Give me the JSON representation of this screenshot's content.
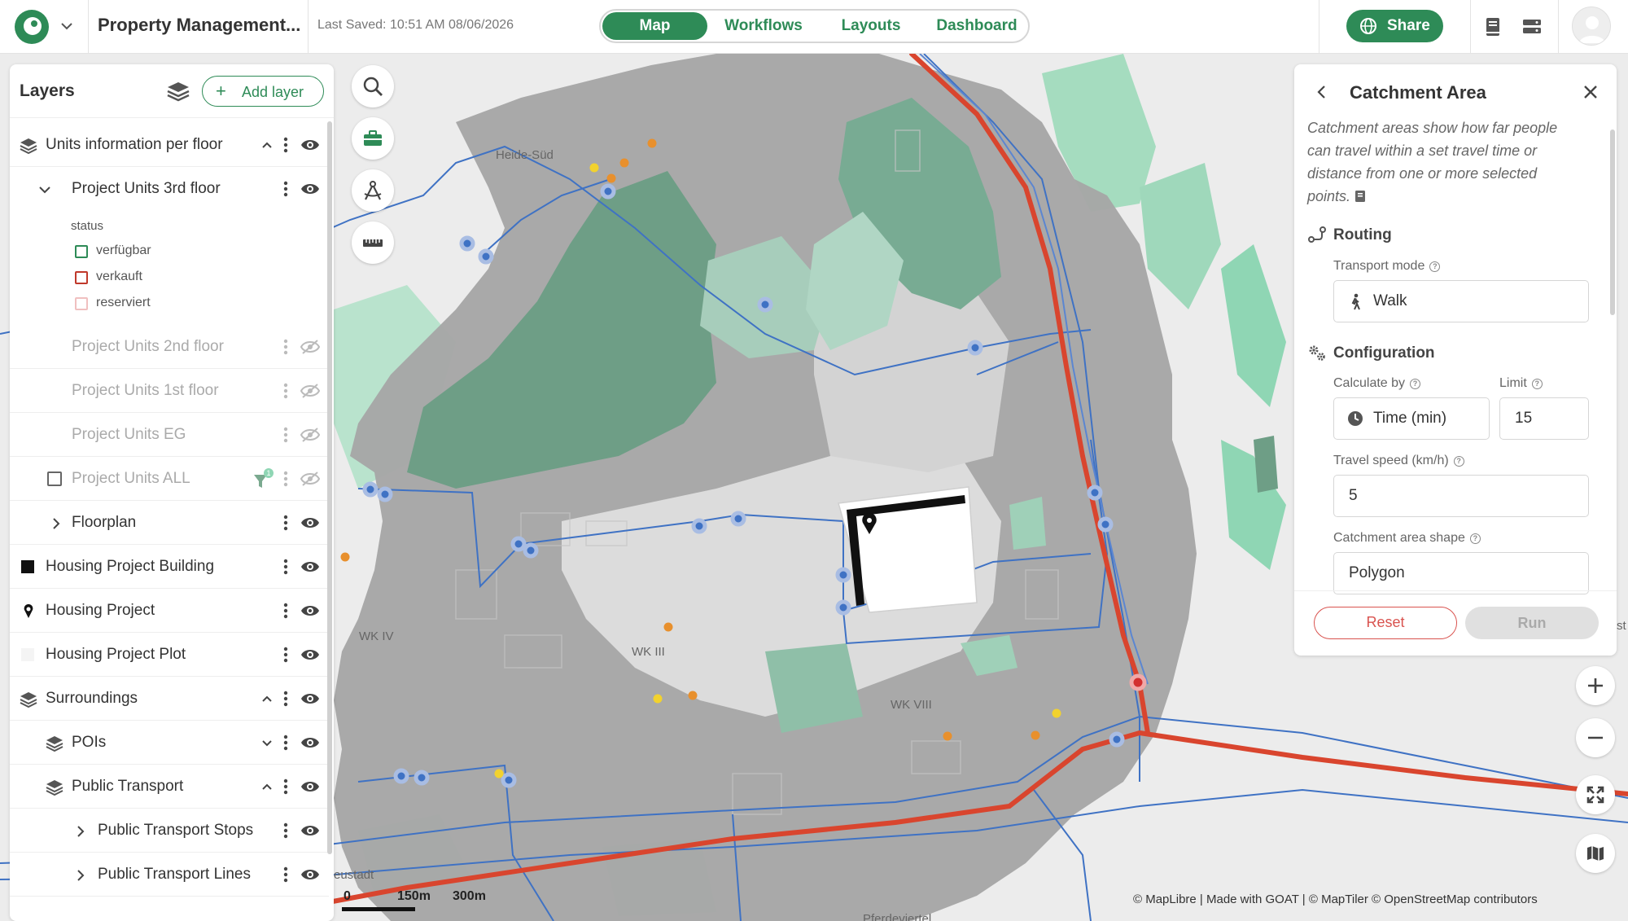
{
  "header": {
    "project_title": "Property Management...",
    "last_saved": "Last Saved: 10:51 AM 08/06/2026",
    "tabs": [
      {
        "label": "Map",
        "active": true
      },
      {
        "label": "Workflows",
        "active": false
      },
      {
        "label": "Layouts",
        "active": false
      },
      {
        "label": "Dashboard",
        "active": false
      }
    ],
    "share_label": "Share"
  },
  "layers_panel": {
    "title": "Layers",
    "add_layer_label": "Add layer",
    "rows": [
      {
        "label": "Units information per floor",
        "visible": true,
        "expanded": true,
        "type": "group"
      },
      {
        "label": "Project Units 3rd floor",
        "visible": true,
        "expanded": true,
        "type": "layer"
      },
      {
        "label": "Project Units 2nd floor",
        "visible": false,
        "type": "layer"
      },
      {
        "label": "Project Units 1st floor",
        "visible": false,
        "type": "layer"
      },
      {
        "label": "Project Units EG",
        "visible": false,
        "type": "layer"
      },
      {
        "label": "Project Units ALL",
        "visible": false,
        "type": "layer",
        "filter_badge": "1"
      },
      {
        "label": "Floorplan",
        "visible": true,
        "type": "layer"
      },
      {
        "label": "Housing Project Building",
        "visible": true,
        "type": "layer"
      },
      {
        "label": "Housing Project",
        "visible": true,
        "type": "layer"
      },
      {
        "label": "Housing Project Plot",
        "visible": true,
        "type": "layer"
      },
      {
        "label": "Surroundings",
        "visible": true,
        "expanded": true,
        "type": "group"
      },
      {
        "label": "POIs",
        "visible": true,
        "type": "group"
      },
      {
        "label": "Public Transport",
        "visible": true,
        "expanded": true,
        "type": "group"
      },
      {
        "label": "Public Transport Stops",
        "visible": true,
        "type": "layer"
      },
      {
        "label": "Public Transport Lines",
        "visible": true,
        "type": "layer"
      }
    ],
    "legend": {
      "title": "status",
      "items": [
        {
          "label": "verfügbar",
          "color": "#2e8b57"
        },
        {
          "label": "verkauft",
          "color": "#c0392b"
        },
        {
          "label": "reserviert",
          "color": "#f0c0c0"
        }
      ]
    }
  },
  "catchment": {
    "title": "Catchment Area",
    "description_lines": [
      "Catchment areas show how far people",
      "can travel within a set travel time or",
      "distance from one or more selected",
      "points."
    ],
    "routing_title": "Routing",
    "transport_mode_label": "Transport mode",
    "transport_mode_value": "Walk",
    "configuration_title": "Configuration",
    "calculate_by_label": "Calculate by",
    "calculate_by_value": "Time (min)",
    "limit_label": "Limit",
    "limit_value": "15",
    "travel_speed_label": "Travel speed (km/h)",
    "travel_speed_value": "5",
    "shape_label": "Catchment area shape",
    "shape_value": "Polygon",
    "reset_label": "Reset",
    "run_label": "Run"
  },
  "map": {
    "labels": [
      "Heide-Süd",
      "WK IV",
      "WK III",
      "WK VIII",
      "eustadt",
      "Pferdeviertel",
      "st"
    ],
    "scale": [
      "0",
      "150m",
      "300m"
    ],
    "attribution": "© MapLibre | Made with GOAT | © MapTiler © OpenStreetMap contributors"
  },
  "colors": {
    "accent": "#2e8b57",
    "catchment_gray": "#9a9a9a",
    "green_area": "#8fd6b4",
    "transit_blue": "#3f72c4",
    "rail_red": "#d9452e"
  }
}
